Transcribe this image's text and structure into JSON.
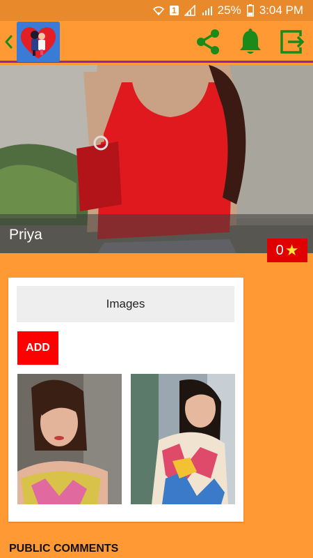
{
  "status": {
    "battery": "25%",
    "time": "3:04 PM",
    "sim": "1"
  },
  "toolbar": {
    "back_icon": "chevron-left-icon",
    "share_icon": "share-icon",
    "notification_icon": "bell-icon",
    "exit_icon": "exit-icon",
    "icon_color": "#1A8A1A"
  },
  "profile": {
    "name": "Priya",
    "rating": "0",
    "star": "★"
  },
  "images": {
    "header": "Images",
    "add_label": "ADD"
  },
  "comments": {
    "heading": "PUBLIC COMMENTS"
  },
  "colors": {
    "background": "#FF9933",
    "accent_line": "#8E24AA",
    "badge": "#E00000",
    "add_button": "#FF0000"
  }
}
